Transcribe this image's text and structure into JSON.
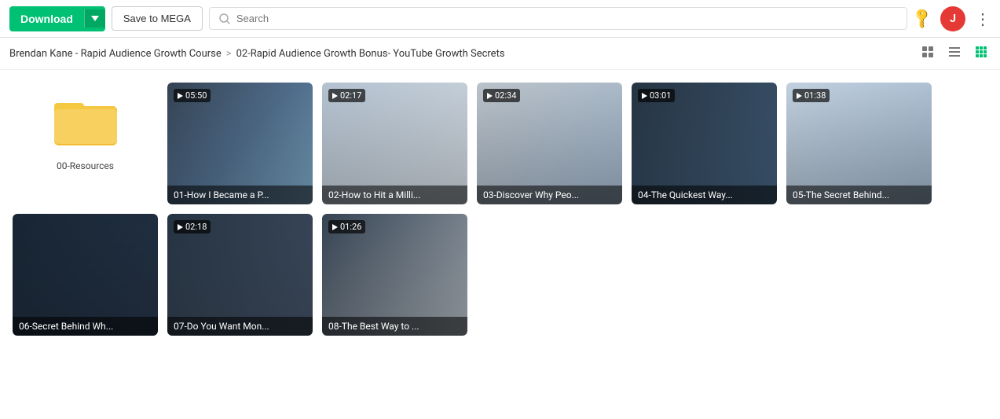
{
  "header": {
    "download_label": "Download",
    "save_label": "Save to MEGA",
    "search_placeholder": "Search",
    "avatar_initial": "J",
    "avatar_color": "#e53935"
  },
  "breadcrumb": {
    "parent": "Brendan Kane - Rapid Audience Growth Course",
    "separator": ">",
    "current": "02-Rapid Audience Growth Bonus- YouTube Growth Secrets"
  },
  "files": [
    {
      "type": "folder",
      "name": "00-Resources",
      "icon": "📁"
    },
    {
      "type": "video",
      "name": "01-How I Became a P...",
      "duration": "05:50",
      "thumb_class": "thumb-1"
    },
    {
      "type": "video",
      "name": "02-How to Hit a Milli...",
      "duration": "02:17",
      "thumb_class": "thumb-2"
    },
    {
      "type": "video",
      "name": "03-Discover Why Peo...",
      "duration": "02:34",
      "thumb_class": "thumb-3"
    },
    {
      "type": "video",
      "name": "04-The Quickest Way...",
      "duration": "03:01",
      "thumb_class": "thumb-4"
    },
    {
      "type": "video",
      "name": "05-The Secret Behind...",
      "duration": "01:38",
      "thumb_class": "thumb-5"
    },
    {
      "type": "video",
      "name": "06-Secret Behind Wh...",
      "duration": "",
      "thumb_class": "thumb-6"
    },
    {
      "type": "video",
      "name": "07-Do You Want Mon...",
      "duration": "02:18",
      "thumb_class": "thumb-7"
    },
    {
      "type": "video",
      "name": "08-The Best Way to ...",
      "duration": "01:26",
      "thumb_class": "thumb-8"
    }
  ]
}
